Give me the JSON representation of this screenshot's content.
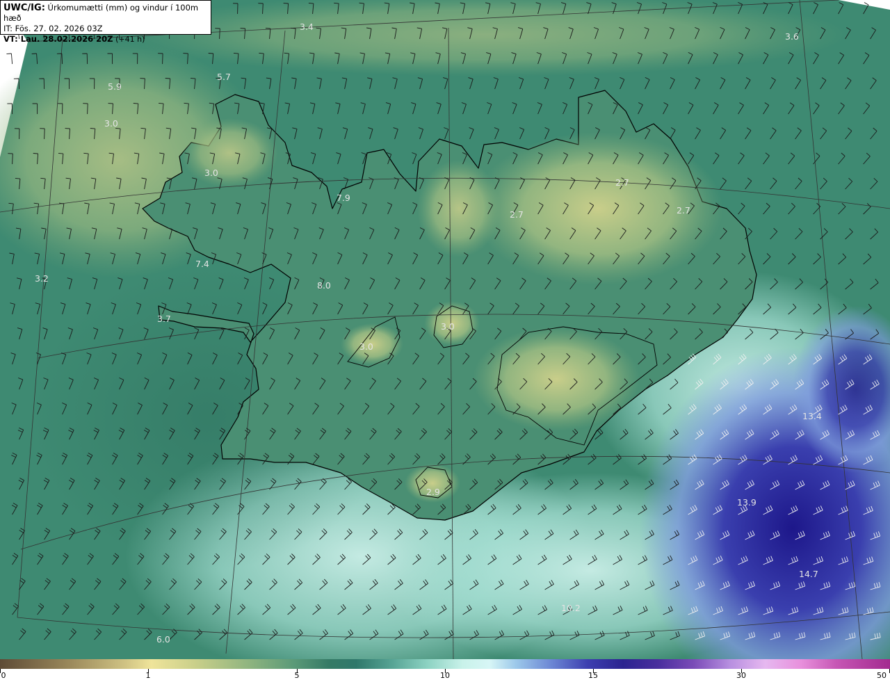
{
  "header": {
    "model": "UWC/IG:",
    "title": "Úrkomumætti (mm) og vindur í 100m hæð",
    "init_time": "IT: Fös. 27. 02. 2026 03Z",
    "valid_prefix": "VT: Lau. 28.02.2026 20Z",
    "lead": "(+41 h)"
  },
  "colors": {
    "low": "#8fb47f",
    "mid": "#2f786b",
    "high": "#c9f2ea",
    "very_high": "#2b2390",
    "coast": "#000000",
    "value_text": "#e4e4e4"
  },
  "values": [
    {
      "text": "3.4"
    },
    {
      "text": "3.6"
    },
    {
      "text": "5.7"
    },
    {
      "text": "5.9"
    },
    {
      "text": "3.0"
    },
    {
      "text": "3.0"
    },
    {
      "text": "7.9"
    },
    {
      "text": "2.7"
    },
    {
      "text": "2.7"
    },
    {
      "text": "2.7"
    },
    {
      "text": "7.4"
    },
    {
      "text": "3.2"
    },
    {
      "text": "8.0"
    },
    {
      "text": "3.7"
    },
    {
      "text": "3.0"
    },
    {
      "text": "3.0"
    },
    {
      "text": "13.4"
    },
    {
      "text": "2.9"
    },
    {
      "text": "13.9"
    },
    {
      "text": "14.7"
    },
    {
      "text": "10.2"
    },
    {
      "text": "6.0"
    }
  ],
  "colorbar": {
    "ticks": [
      "0",
      "1",
      "5",
      "10",
      "15",
      "30",
      "50"
    ]
  }
}
